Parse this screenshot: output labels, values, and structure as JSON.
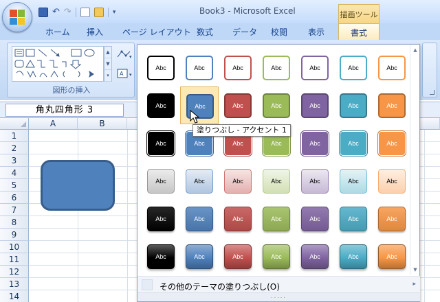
{
  "window": {
    "title": "Book3 - Microsoft Excel",
    "context_tab_header": "描画ツール"
  },
  "quick_access": {
    "save_icon": "save-icon",
    "undo_icon": "↶",
    "redo_icon": "↷",
    "dropdown": "▾"
  },
  "tabs": [
    {
      "label": "ホーム"
    },
    {
      "label": "挿入"
    },
    {
      "label": "ページ レイアウト"
    },
    {
      "label": "数式"
    },
    {
      "label": "データ"
    },
    {
      "label": "校閲"
    },
    {
      "label": "表示"
    },
    {
      "label": "書式",
      "active": true
    }
  ],
  "ribbon": {
    "group_label": "図形の挿入"
  },
  "formula_bar": {
    "name_box": "角丸四角形 3"
  },
  "sheet": {
    "columns": [
      "A",
      "B"
    ],
    "rows": [
      "1",
      "2",
      "3",
      "4",
      "5",
      "6",
      "7",
      "8",
      "9",
      "10",
      "11",
      "12",
      "13",
      "14"
    ]
  },
  "style_gallery": {
    "swatch_text": "Abc",
    "accent_colors": [
      "#000000",
      "#4f81bd",
      "#c0504d",
      "#9bbb59",
      "#8064a2",
      "#4bacc6",
      "#f79646"
    ],
    "rows": [
      {
        "style": "outline"
      },
      {
        "style": "solid"
      },
      {
        "style": "soft"
      },
      {
        "style": "light"
      },
      {
        "style": "intense"
      },
      {
        "style": "gloss"
      }
    ],
    "hovered": {
      "row": 1,
      "col": 1
    },
    "more_label": "その他のテーマの塗りつぶし(O)",
    "more_arrow": "▸",
    "grip": "....."
  },
  "tooltip": {
    "text": "塗りつぶし - アクセント 1"
  }
}
